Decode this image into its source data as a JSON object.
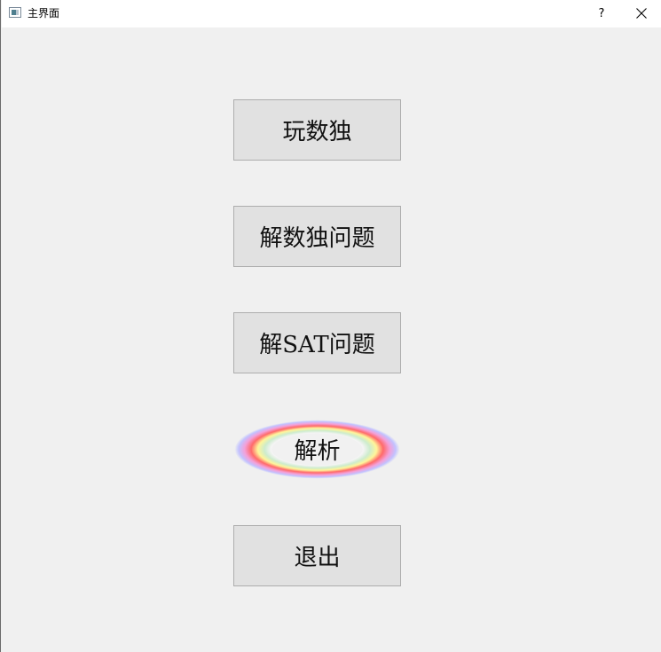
{
  "window": {
    "title": "主界面",
    "help_label": "?",
    "icons": {
      "app": "window-app-icon",
      "close": "close-icon"
    }
  },
  "menu": {
    "play_sudoku": "玩数独",
    "solve_sudoku": "解数独问题",
    "solve_sat": "解SAT问题",
    "parse": "解析",
    "exit": "退出"
  },
  "colors": {
    "background": "#f0f0f0",
    "button_face": "#e1e1e1",
    "button_border": "#adadad",
    "ring_outer": "#b4b4ff",
    "ring_red": "#ff5a5a",
    "ring_yellow": "#fff59a",
    "ring_green": "#c8ecc8"
  }
}
